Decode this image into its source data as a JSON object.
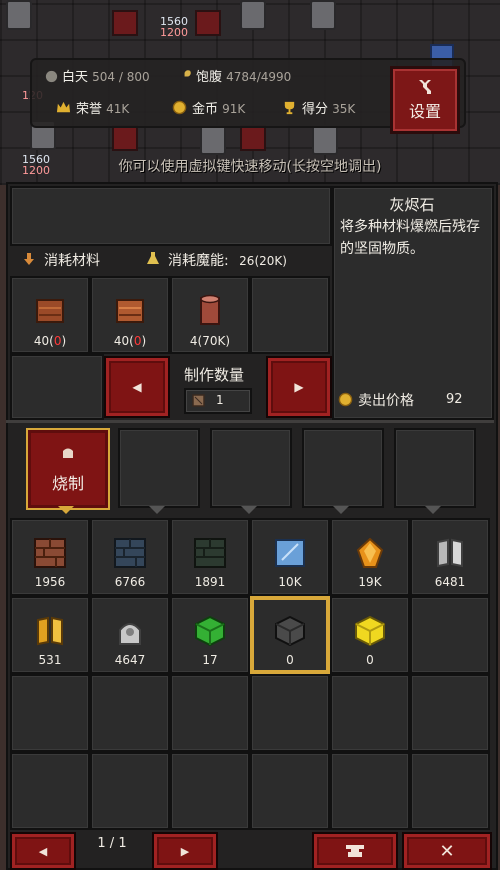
{
  "hud": {
    "day_label": "白天",
    "day_value": "504 / 800",
    "satiety_label": "饱腹",
    "satiety_value": "4784/4990",
    "honor_label": "荣誉",
    "honor_value": "41K",
    "gold_label": "金币",
    "gold_value": "91K",
    "score_label": "得分",
    "score_value": "35K",
    "settings_label": "设置"
  },
  "background": {
    "counters": [
      {
        "top": "1560",
        "bottom": "1200"
      },
      {
        "top": "1560",
        "bottom": "1200"
      },
      {
        "top": "1560",
        "bottom": "1200"
      }
    ],
    "side_red": "120"
  },
  "hint": "你可以使用虚拟键快速移动(长按空地调出)",
  "craft": {
    "materials_label": "消耗材料",
    "mana_label": "消耗魔能:",
    "mana_value": "26(20K)",
    "materials": [
      {
        "icon": "plank-icon",
        "have": "40",
        "need": "0"
      },
      {
        "icon": "plank-icon",
        "have": "40",
        "need": "0"
      },
      {
        "icon": "log-icon",
        "count": "4(70K)"
      }
    ],
    "quantity_label": "制作数量",
    "quantity_value": "1"
  },
  "description": {
    "title": "灰烬石",
    "text": "将多种材料爆燃后残存的坚固物质。",
    "sell_label": "卖出价格",
    "sell_price": "92"
  },
  "tabs": [
    {
      "label": "烧制",
      "active": true
    },
    {
      "label": "",
      "active": false
    },
    {
      "label": "",
      "active": false
    },
    {
      "label": "",
      "active": false
    },
    {
      "label": "",
      "active": false
    }
  ],
  "inventory": [
    {
      "icon": "brown-brick-icon",
      "count": "1956",
      "color": "#8a4a34"
    },
    {
      "icon": "blue-brick-icon",
      "count": "6766",
      "color": "#34465a"
    },
    {
      "icon": "dark-brick-icon",
      "count": "1891",
      "color": "#2c3a30"
    },
    {
      "icon": "glass-block-icon",
      "count": "10K",
      "color": "#6aa0d8"
    },
    {
      "icon": "amber-crystal-icon",
      "count": "19K",
      "color": "#e8921a"
    },
    {
      "icon": "silver-book-icon",
      "count": "6481",
      "color": "#b8b8b8"
    },
    {
      "icon": "gold-book-icon",
      "count": "531",
      "color": "#e0a020"
    },
    {
      "icon": "silver-ore-icon",
      "count": "4647",
      "color": "#c8c8c8"
    },
    {
      "icon": "green-cube-icon",
      "count": "17",
      "color": "#34b034"
    },
    {
      "icon": "ash-stone-icon",
      "count": "0",
      "color": "#4a4a4a",
      "selected": true
    },
    {
      "icon": "yellow-cube-icon",
      "count": "0",
      "color": "#f0d820"
    }
  ],
  "pager": {
    "text": "1 / 1"
  },
  "colors": {
    "accent_red": "#7f1414",
    "selected_gold": "#d8a83a",
    "panel_bg": "#232222"
  }
}
